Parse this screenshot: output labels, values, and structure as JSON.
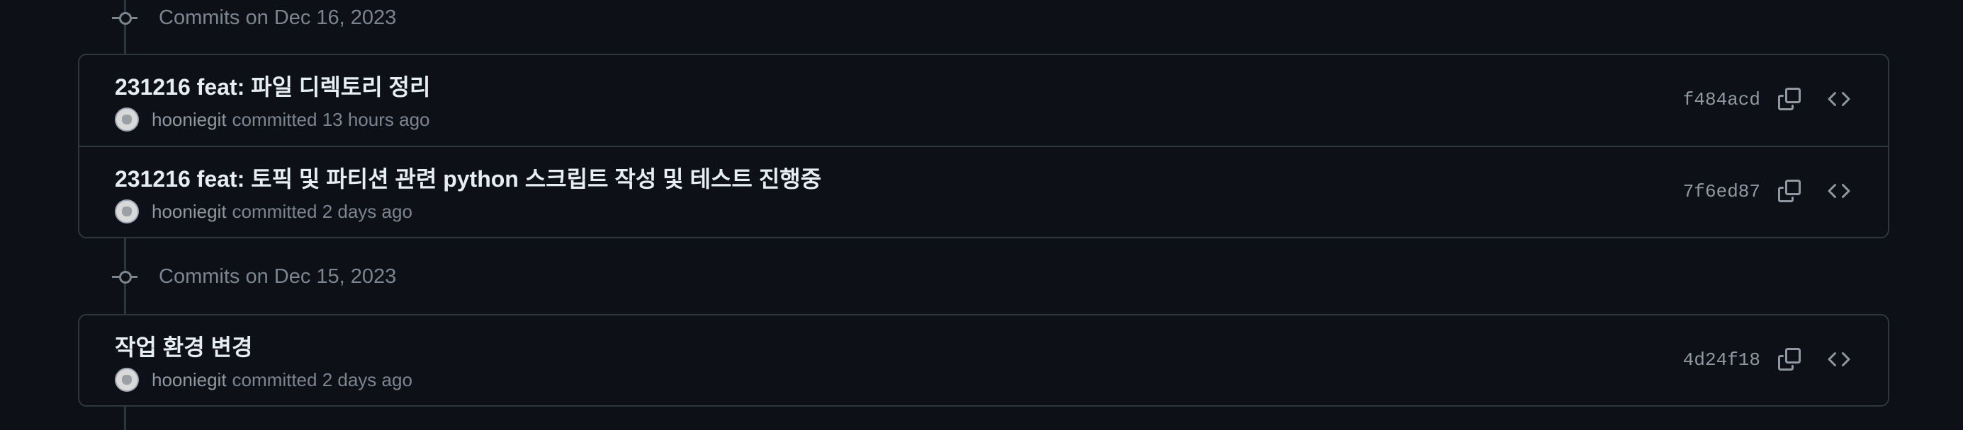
{
  "groups": [
    {
      "label": "Commits on Dec 16, 2023",
      "commits": [
        {
          "title": "231216 feat: 파일 디렉토리 정리",
          "author": "hooniegit",
          "action": "committed",
          "time": "13 hours ago",
          "sha": "f484acd"
        },
        {
          "title": "231216 feat: 토픽 및 파티션 관련 python 스크립트 작성 및 테스트 진행중",
          "author": "hooniegit",
          "action": "committed",
          "time": "2 days ago",
          "sha": "7f6ed87"
        }
      ]
    },
    {
      "label": "Commits on Dec 15, 2023",
      "commits": [
        {
          "title": "작업 환경 변경",
          "author": "hooniegit",
          "action": "committed",
          "time": "2 days ago",
          "sha": "4d24f18"
        }
      ]
    }
  ],
  "icons": {
    "commit": "git-commit-icon",
    "copy": "copy-icon",
    "browse": "code-icon"
  },
  "colors": {
    "background": "#0d1117",
    "border": "#30363d",
    "muted_text": "#7d8590",
    "primary_text": "#e6edf3"
  }
}
